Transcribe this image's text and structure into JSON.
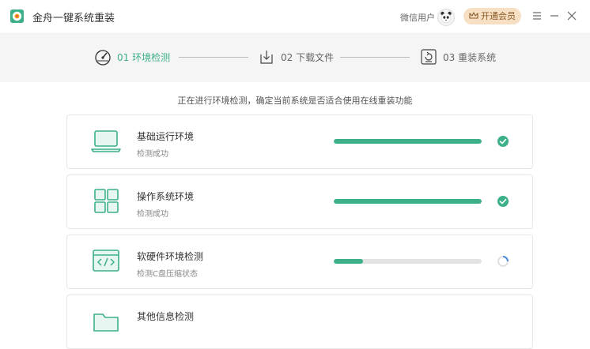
{
  "window": {
    "title": "金舟一键系统重装",
    "user_label": "微信用户",
    "vip_label": "开通会员",
    "icons": {
      "logo": "app-logo-icon",
      "avatar": "panda-avatar",
      "vip": "crown-icon",
      "menu": "menu-icon",
      "minimize": "minimize-icon",
      "close": "close-icon"
    }
  },
  "steps": [
    {
      "label": "01 环境检测",
      "icon": "gauge-icon",
      "active": true
    },
    {
      "label": "02 下载文件",
      "icon": "download-icon",
      "active": false
    },
    {
      "label": "03 重装系统",
      "icon": "reinstall-icon",
      "active": false
    }
  ],
  "status_text": "正在进行环境检测，确定当前系统是否适合使用在线重装功能",
  "checks": [
    {
      "title": "基础运行环境",
      "subtitle": "检测成功",
      "icon": "laptop-icon",
      "progress": 1.0,
      "state": "done"
    },
    {
      "title": "操作系统环境",
      "subtitle": "检测成功",
      "icon": "windows-grid-icon",
      "progress": 1.0,
      "state": "done"
    },
    {
      "title": "软硬件环境检测",
      "subtitle": "检测C盘压缩状态",
      "icon": "code-window-icon",
      "progress": 0.2,
      "state": "loading"
    },
    {
      "title": "其他信息检测",
      "subtitle": "",
      "icon": "folder-icon",
      "progress": 0,
      "state": "pending"
    }
  ],
  "colors": {
    "accent": "#3db08a",
    "step_active": "#3db08a",
    "step_inactive": "#666666",
    "vip_bg": "#f6dfc2",
    "vip_text": "#8a5a27",
    "track": "#e3e3e3"
  }
}
